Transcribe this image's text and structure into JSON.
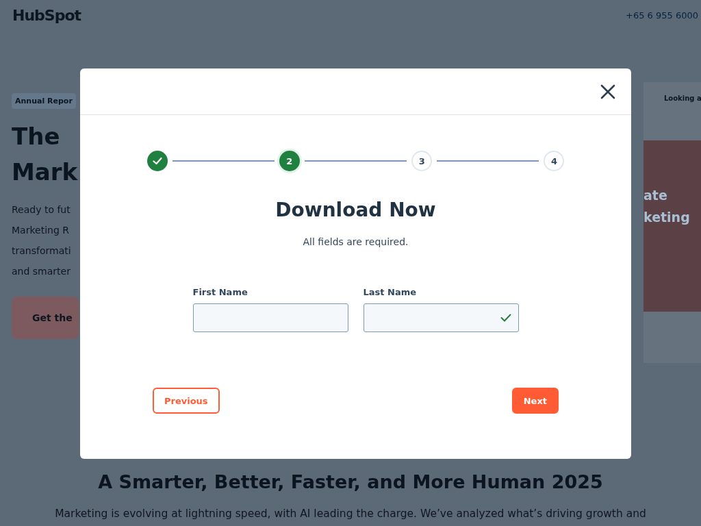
{
  "header": {
    "logo": "HubSpot",
    "phone": "+65 6 955 6000"
  },
  "hero": {
    "badge": "Annual Repor",
    "title_lines": [
      "The",
      "Mark"
    ],
    "text_lines": [
      "Ready to fut",
      "Marketing R",
      "transformati",
      "and smarter"
    ],
    "cta": "Get the"
  },
  "preview": {
    "heading": "Looking a",
    "big_lines": [
      "ate",
      "keting"
    ]
  },
  "modal": {
    "steps": [
      {
        "complete": true,
        "selected": false
      },
      {
        "label": "2",
        "complete": false,
        "selected": true
      },
      {
        "label": "3",
        "complete": false,
        "selected": false
      },
      {
        "label": "4",
        "complete": false,
        "selected": false
      }
    ],
    "title": "Download Now",
    "subtitle": "All fields are required.",
    "fields": [
      {
        "label": "First Name",
        "valid": false
      },
      {
        "label": "Last Name",
        "valid": true
      }
    ],
    "buttons": [
      {
        "label": "Previous",
        "kind": "secondary"
      },
      {
        "label": "Next",
        "kind": "primary"
      }
    ]
  },
  "section": {
    "heading": "A Smarter, Better, Faster, and More Human 2025",
    "text": "Marketing is evolving at lightning speed, with AI leading the charge. We’ve analyzed what’s driving growth and"
  }
}
